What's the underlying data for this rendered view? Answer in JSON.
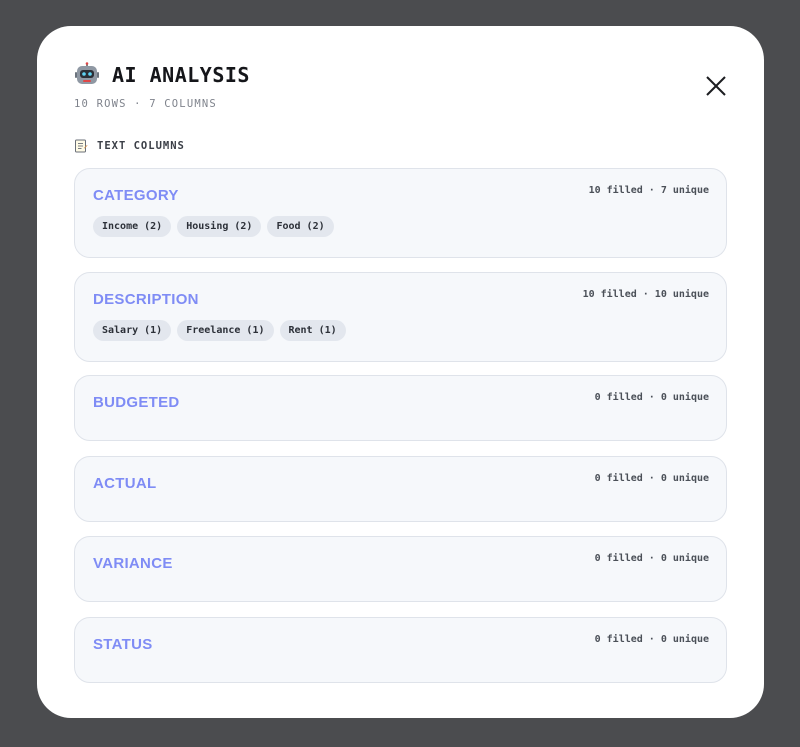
{
  "modal": {
    "title": "AI ANALYSIS",
    "subtitle": "10 ROWS · 7 COLUMNS",
    "icons": {
      "title_icon": "robot-icon",
      "close_icon": "close-icon",
      "section_icon": "memo-icon"
    }
  },
  "section": {
    "label": "TEXT COLUMNS"
  },
  "columns": [
    {
      "name": "CATEGORY",
      "stats": "10 filled · 7 unique",
      "chips": [
        "Income (2)",
        "Housing (2)",
        "Food (2)"
      ]
    },
    {
      "name": "DESCRIPTION",
      "stats": "10 filled · 10 unique",
      "chips": [
        "Salary (1)",
        "Freelance (1)",
        "Rent (1)"
      ]
    },
    {
      "name": "BUDGETED",
      "stats": "0 filled · 0 unique",
      "chips": []
    },
    {
      "name": "ACTUAL",
      "stats": "0 filled · 0 unique",
      "chips": []
    },
    {
      "name": "VARIANCE",
      "stats": "0 filled · 0 unique",
      "chips": []
    },
    {
      "name": "STATUS",
      "stats": "0 filled · 0 unique",
      "chips": []
    }
  ],
  "colors": {
    "overlay": "#4b4c4f",
    "modal_bg": "#ffffff",
    "card_bg": "#f6f8fb",
    "column_name": "#7f8cf5",
    "chip_bg": "#e3e7ee"
  }
}
